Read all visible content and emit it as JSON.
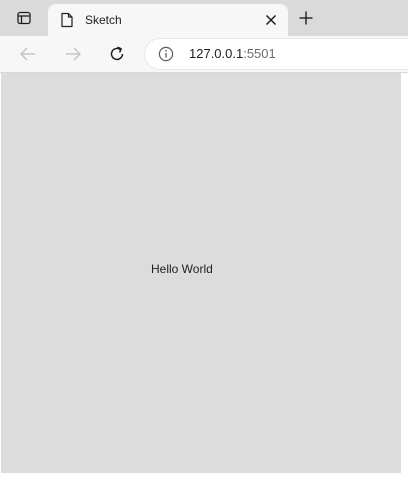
{
  "browser": {
    "tab": {
      "title": "Sketch"
    },
    "address_bar": {
      "host": "127.0.0.1",
      "port": ":5501"
    },
    "icons": {
      "tab_actions": "tab-actions-icon",
      "page": "page-icon",
      "close": "close-icon",
      "new_tab": "plus-icon",
      "back": "arrow-left-icon",
      "forward": "arrow-right-icon",
      "reload": "reload-icon",
      "site_info": "info-icon"
    }
  },
  "page": {
    "canvas_color": "#dcdcdc",
    "text": "Hello World"
  }
}
